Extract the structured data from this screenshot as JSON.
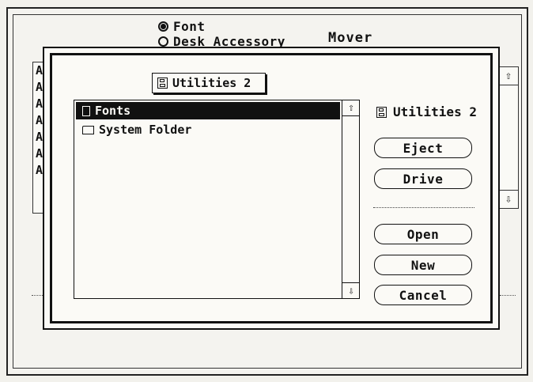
{
  "mover": {
    "title": "Mover",
    "radio_font": "Font",
    "radio_desk": "Desk Accessory",
    "list_items": [
      "Au",
      "Au",
      "Au",
      "Au",
      "Au",
      "Au",
      "Au"
    ],
    "up_arrow": "⇧",
    "down_arrow": "⇩"
  },
  "dialog": {
    "volume_popup": "Utilities 2",
    "files": [
      {
        "name": "Fonts",
        "type": "document",
        "selected": true
      },
      {
        "name": "System Folder",
        "type": "folder",
        "selected": false
      }
    ],
    "scroll_up": "⇧",
    "scroll_down": "⇩",
    "disk_name": "Utilities 2",
    "buttons": {
      "eject": "Eject",
      "drive": "Drive",
      "open": "Open",
      "new": "New",
      "cancel": "Cancel"
    }
  }
}
